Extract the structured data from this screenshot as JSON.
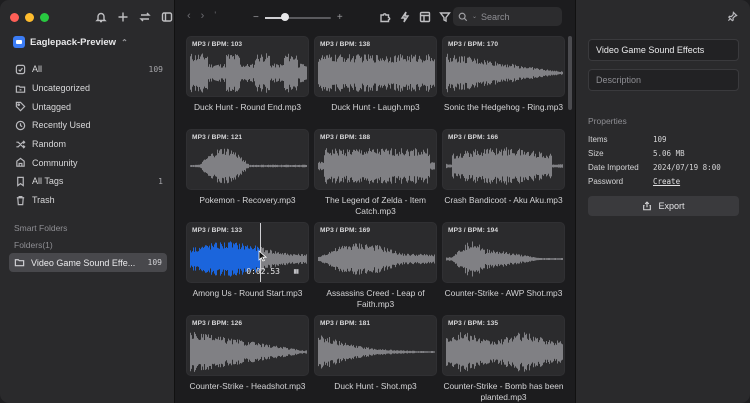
{
  "library": {
    "name": "Eaglepack-Preview"
  },
  "sidebar": {
    "items": [
      {
        "label": "All",
        "count": "109",
        "icon": "all-icon"
      },
      {
        "label": "Uncategorized",
        "count": "",
        "icon": "uncategorized-icon"
      },
      {
        "label": "Untagged",
        "count": "",
        "icon": "tag-icon"
      },
      {
        "label": "Recently Used",
        "count": "",
        "icon": "clock-icon"
      },
      {
        "label": "Random",
        "count": "",
        "icon": "shuffle-icon"
      },
      {
        "label": "Community",
        "count": "",
        "icon": "community-icon"
      },
      {
        "label": "All Tags",
        "count": "1",
        "icon": "bookmark-icon"
      },
      {
        "label": "Trash",
        "count": "",
        "icon": "trash-icon"
      }
    ],
    "smart_folders_label": "Smart Folders",
    "folders_label": "Folders(1)",
    "folder": {
      "label": "Video Game Sound Effe...",
      "count": "109"
    }
  },
  "toolbar": {
    "zoom_minus": "−",
    "zoom_plus": "+",
    "zoom_level": 0.3,
    "search_placeholder": "Search"
  },
  "grid": {
    "cards": [
      {
        "bpm": "MP3 / BPM: 103",
        "title": "Duck Hunt - Round End.mp3",
        "shape": "blocky"
      },
      {
        "bpm": "MP3 / BPM: 138",
        "title": "Duck Hunt - Laugh.mp3",
        "shape": "dense"
      },
      {
        "bpm": "MP3 / BPM: 170",
        "title": "Sonic the Hedgehog - Ring.mp3",
        "shape": "decay"
      },
      {
        "bpm": "MP3 / BPM: 121",
        "title": "Pokemon - Recovery.mp3",
        "shape": "bulge"
      },
      {
        "bpm": "MP3 / BPM: 188",
        "title": "The Legend of Zelda - Item Catch.mp3",
        "shape": "blocky2"
      },
      {
        "bpm": "MP3 / BPM: 166",
        "title": "Crash Bandicoot - Aku Aku.mp3",
        "shape": "burst"
      },
      {
        "bpm": "MP3 / BPM: 133",
        "title": "Among Us - Round Start.mp3",
        "shape": "noise",
        "playing": true,
        "time": "0:02.53",
        "progress": 0.6
      },
      {
        "bpm": "MP3 / BPM: 169",
        "title": "Assassins Creed - Leap of Faith.mp3",
        "shape": "swell"
      },
      {
        "bpm": "MP3 / BPM: 194",
        "title": "Counter-Strike - AWP Shot.mp3",
        "shape": "spike"
      },
      {
        "bpm": "MP3 / BPM: 126",
        "title": "Counter-Strike - Headshot.mp3",
        "shape": "decay2"
      },
      {
        "bpm": "MP3 / BPM: 181",
        "title": "Duck Hunt - Shot.mp3",
        "shape": "decay3"
      },
      {
        "bpm": "MP3 / BPM: 135",
        "title": "Counter-Strike - Bomb has been planted.mp3",
        "shape": "dense2"
      }
    ]
  },
  "inspector": {
    "name": "Video Game Sound Effects",
    "description_placeholder": "Description",
    "properties_label": "Properties",
    "props": [
      {
        "key": "Items",
        "value": "109"
      },
      {
        "key": "Size",
        "value": "5.06 MB"
      },
      {
        "key": "Date Imported",
        "value": "2024/07/19 8:00"
      },
      {
        "key": "Password",
        "value": "Create"
      }
    ],
    "export_label": "Export"
  },
  "colors": {
    "waveform": "#8a8a8e",
    "waveform_played": "#1a6cf0",
    "accent": "#3b7cf5"
  }
}
